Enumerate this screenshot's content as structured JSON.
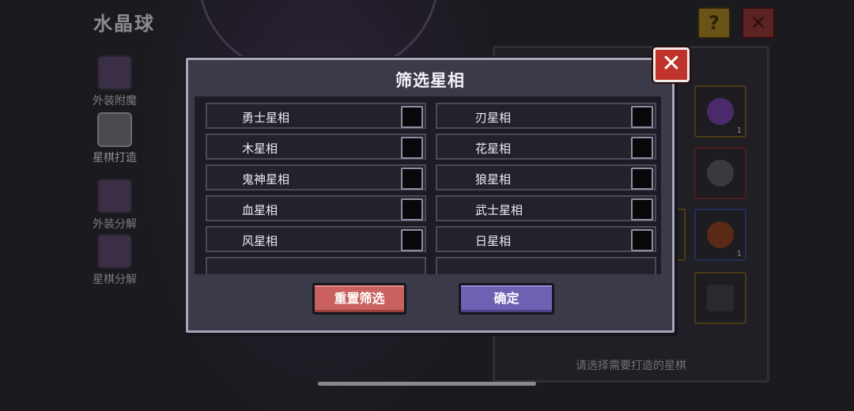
{
  "background": {
    "title": "水晶球",
    "help_icon": "question-icon",
    "close_icon": "close-icon",
    "side_buttons": [
      {
        "label": "外装附魔",
        "icon": "crystal-ball-enchant-icon"
      },
      {
        "label": "星棋打造",
        "icon": "chess-forge-icon",
        "active": true
      },
      {
        "label": "外装分解",
        "icon": "crystal-ball-dismantle-icon"
      },
      {
        "label": "星棋分解",
        "icon": "chess-dismantle-icon"
      }
    ],
    "slot_counts": {
      "a": "1",
      "b": "1",
      "c": "1"
    },
    "hint": "请选择需要打造的星棋"
  },
  "modal": {
    "title": "筛选星相",
    "close_icon": "close-icon",
    "options": [
      {
        "label": "勇士星相",
        "checked": false
      },
      {
        "label": "刃星相",
        "checked": false
      },
      {
        "label": "木星相",
        "checked": false
      },
      {
        "label": "花星相",
        "checked": false
      },
      {
        "label": "鬼神星相",
        "checked": false
      },
      {
        "label": "狼星相",
        "checked": false
      },
      {
        "label": "血星相",
        "checked": false
      },
      {
        "label": "武士星相",
        "checked": false
      },
      {
        "label": "风星相",
        "checked": false
      },
      {
        "label": "日星相",
        "checked": false
      }
    ],
    "reset_label": "重置筛选",
    "confirm_label": "确定"
  },
  "colors": {
    "modal_bg": "#3a3a48",
    "reset_button": "#c9625f",
    "confirm_button": "#7060b4",
    "close_button": "#c0332c"
  }
}
